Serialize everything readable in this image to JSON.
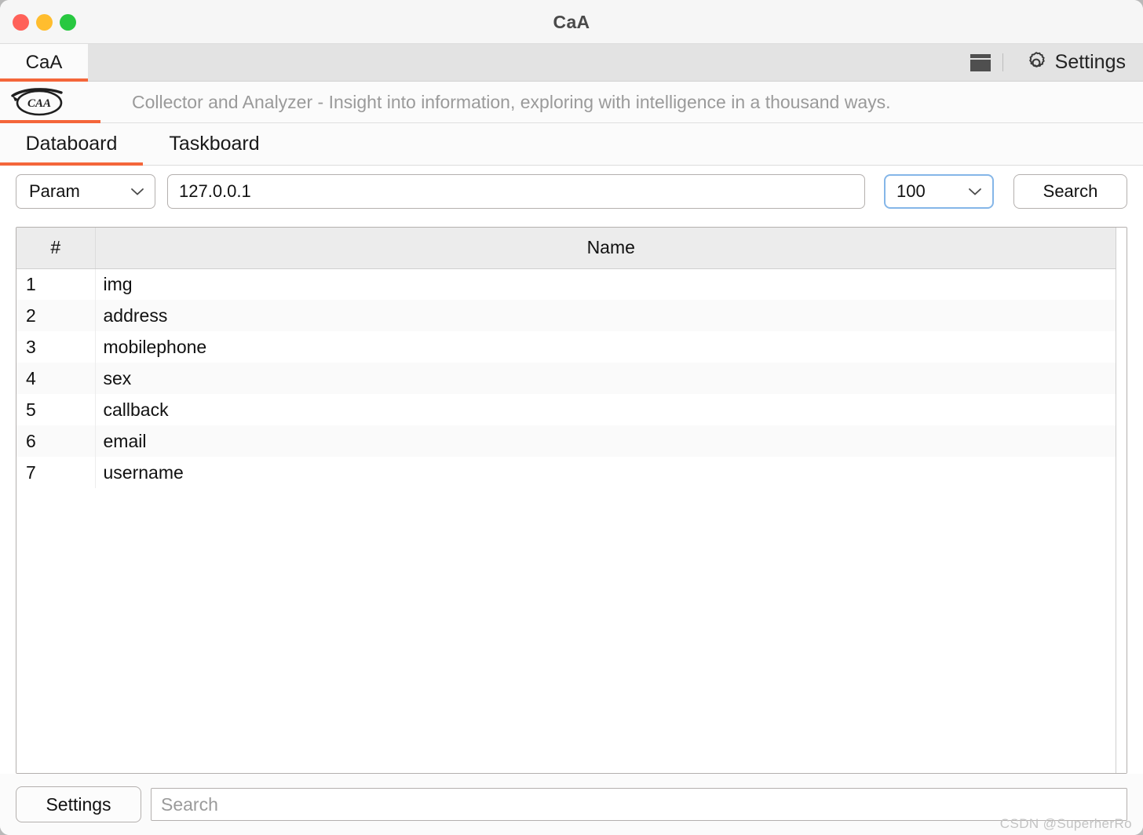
{
  "window": {
    "title": "CaA",
    "traffic_lights": [
      {
        "name": "close",
        "color": "#ff6159"
      },
      {
        "name": "minimize",
        "color": "#ffbd2e"
      },
      {
        "name": "maximize",
        "color": "#28c840"
      }
    ]
  },
  "tabstrip": {
    "app_tab_label": "CaA",
    "panel_icon": "panel-layout-icon",
    "settings_icon": "gear-icon",
    "settings_label": "Settings"
  },
  "brand": {
    "logo_text": "CAA",
    "logo_icon": "caa-logo-icon",
    "tagline": "Collector and Analyzer - Insight into information, exploring with intelligence in a thousand ways."
  },
  "section_tabs": [
    {
      "label": "Databoard",
      "active": true
    },
    {
      "label": "Taskboard",
      "active": false
    }
  ],
  "search_bar": {
    "param_select": {
      "value": "Param",
      "options": [
        "Param"
      ],
      "icon": "chevron-down-icon"
    },
    "url_input": {
      "value": "127.0.0.1",
      "placeholder": ""
    },
    "limit_select": {
      "value": "100",
      "options": [
        "100"
      ],
      "icon": "chevron-down-icon",
      "focus_color": "#85b6e8"
    },
    "search_button_label": "Search"
  },
  "table": {
    "columns": [
      "#",
      "Name"
    ],
    "rows": [
      {
        "index": "1",
        "name": "img"
      },
      {
        "index": "2",
        "name": "address"
      },
      {
        "index": "3",
        "name": "mobilephone"
      },
      {
        "index": "4",
        "name": "sex"
      },
      {
        "index": "5",
        "name": "callback"
      },
      {
        "index": "6",
        "name": "email"
      },
      {
        "index": "7",
        "name": "username"
      }
    ]
  },
  "bottom_bar": {
    "settings_label": "Settings",
    "search_placeholder": "Search",
    "search_value": ""
  },
  "watermark": "CSDN @SuperherRo",
  "colors": {
    "accent": "#f4663a",
    "focus": "#85b6e8",
    "tagline": "#9a9a9a",
    "header_bg": "#ececec"
  }
}
